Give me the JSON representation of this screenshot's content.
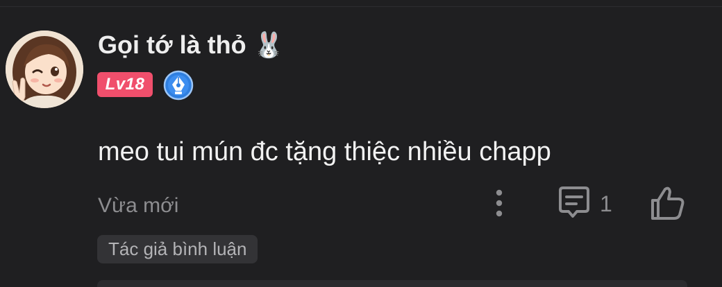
{
  "comment": {
    "username": "Gọi tớ là thỏ 🐰",
    "level_badge": "Lv18",
    "author_badge_icon": "pen-nib-icon",
    "text": "meo tui mún đc tặng thiệc nhiều chapp",
    "timestamp": "Vừa mới",
    "reply_count": "1",
    "author_tag": "Tác giả bình luận"
  },
  "colors": {
    "background": "#1f1f21",
    "level_badge": "#f04f6c",
    "author_badge": "#2f7fe0",
    "muted_text": "#8d8d90",
    "tag_background": "#333336"
  },
  "icons": {
    "more": "more-vertical-icon",
    "reply": "comment-icon",
    "like": "thumbs-up-icon"
  }
}
